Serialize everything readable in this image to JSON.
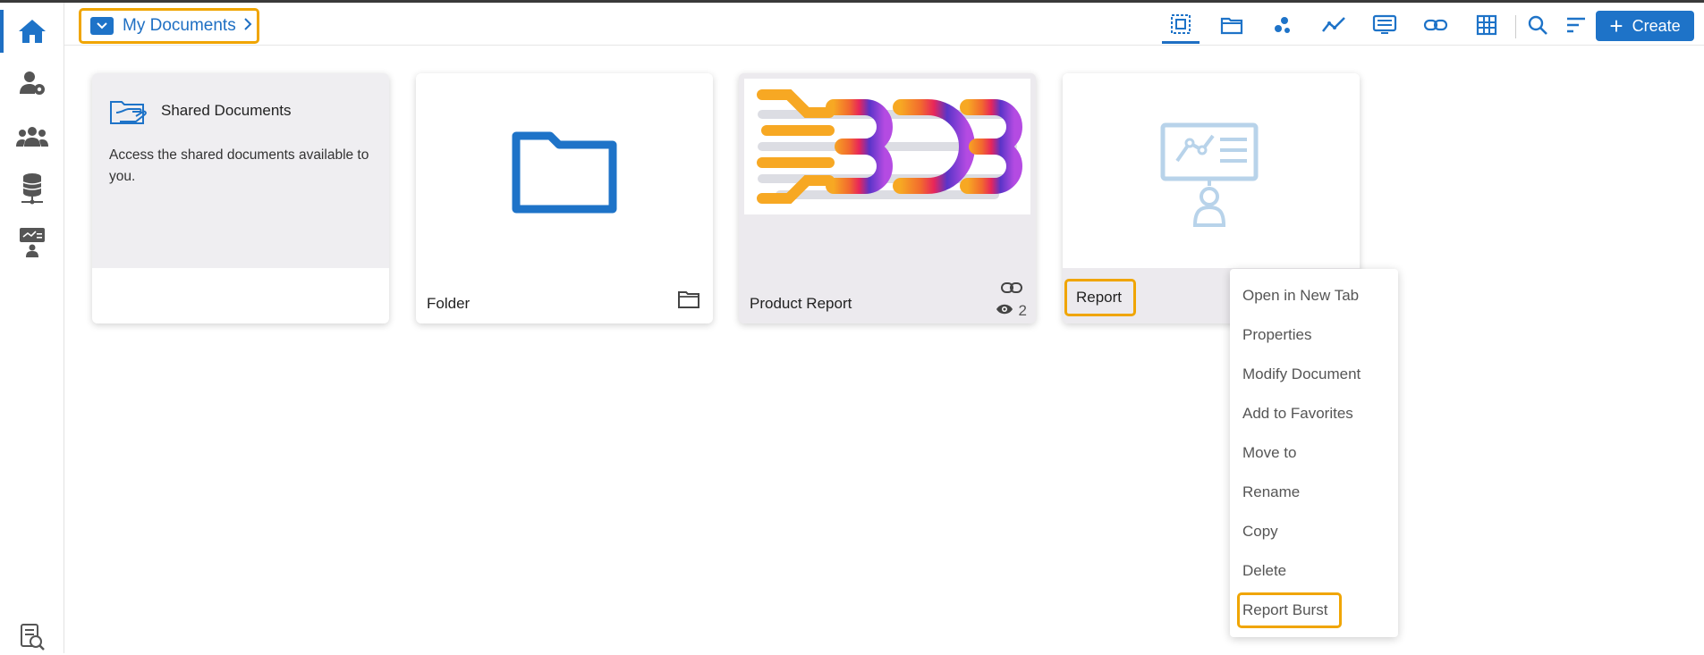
{
  "breadcrumb": {
    "label": "My Documents"
  },
  "toolbar": {
    "create_label": "Create",
    "icons": [
      "all-documents-icon",
      "folder-icon",
      "share-icon",
      "trend-icon",
      "report-icon",
      "link-icon",
      "table-icon",
      "search-icon",
      "sort-icon"
    ]
  },
  "sidebar": {
    "items": [
      "home-icon",
      "user-settings-icon",
      "group-icon",
      "database-icon",
      "presentation-icon",
      "document-search-icon"
    ]
  },
  "cards": {
    "shared": {
      "title": "Shared Documents",
      "description": "Access the shared documents available to you."
    },
    "folder": {
      "title": "Folder"
    },
    "product_report": {
      "title": "Product Report",
      "views": "2"
    },
    "report": {
      "title": "Report"
    }
  },
  "context_menu": {
    "items": [
      "Open in New Tab",
      "Properties",
      "Modify Document",
      "Add to Favorites",
      "Move to",
      "Rename",
      "Copy",
      "Delete",
      "Report Burst"
    ]
  },
  "colors": {
    "accent": "#1e73c8",
    "highlight": "#f0a500"
  }
}
